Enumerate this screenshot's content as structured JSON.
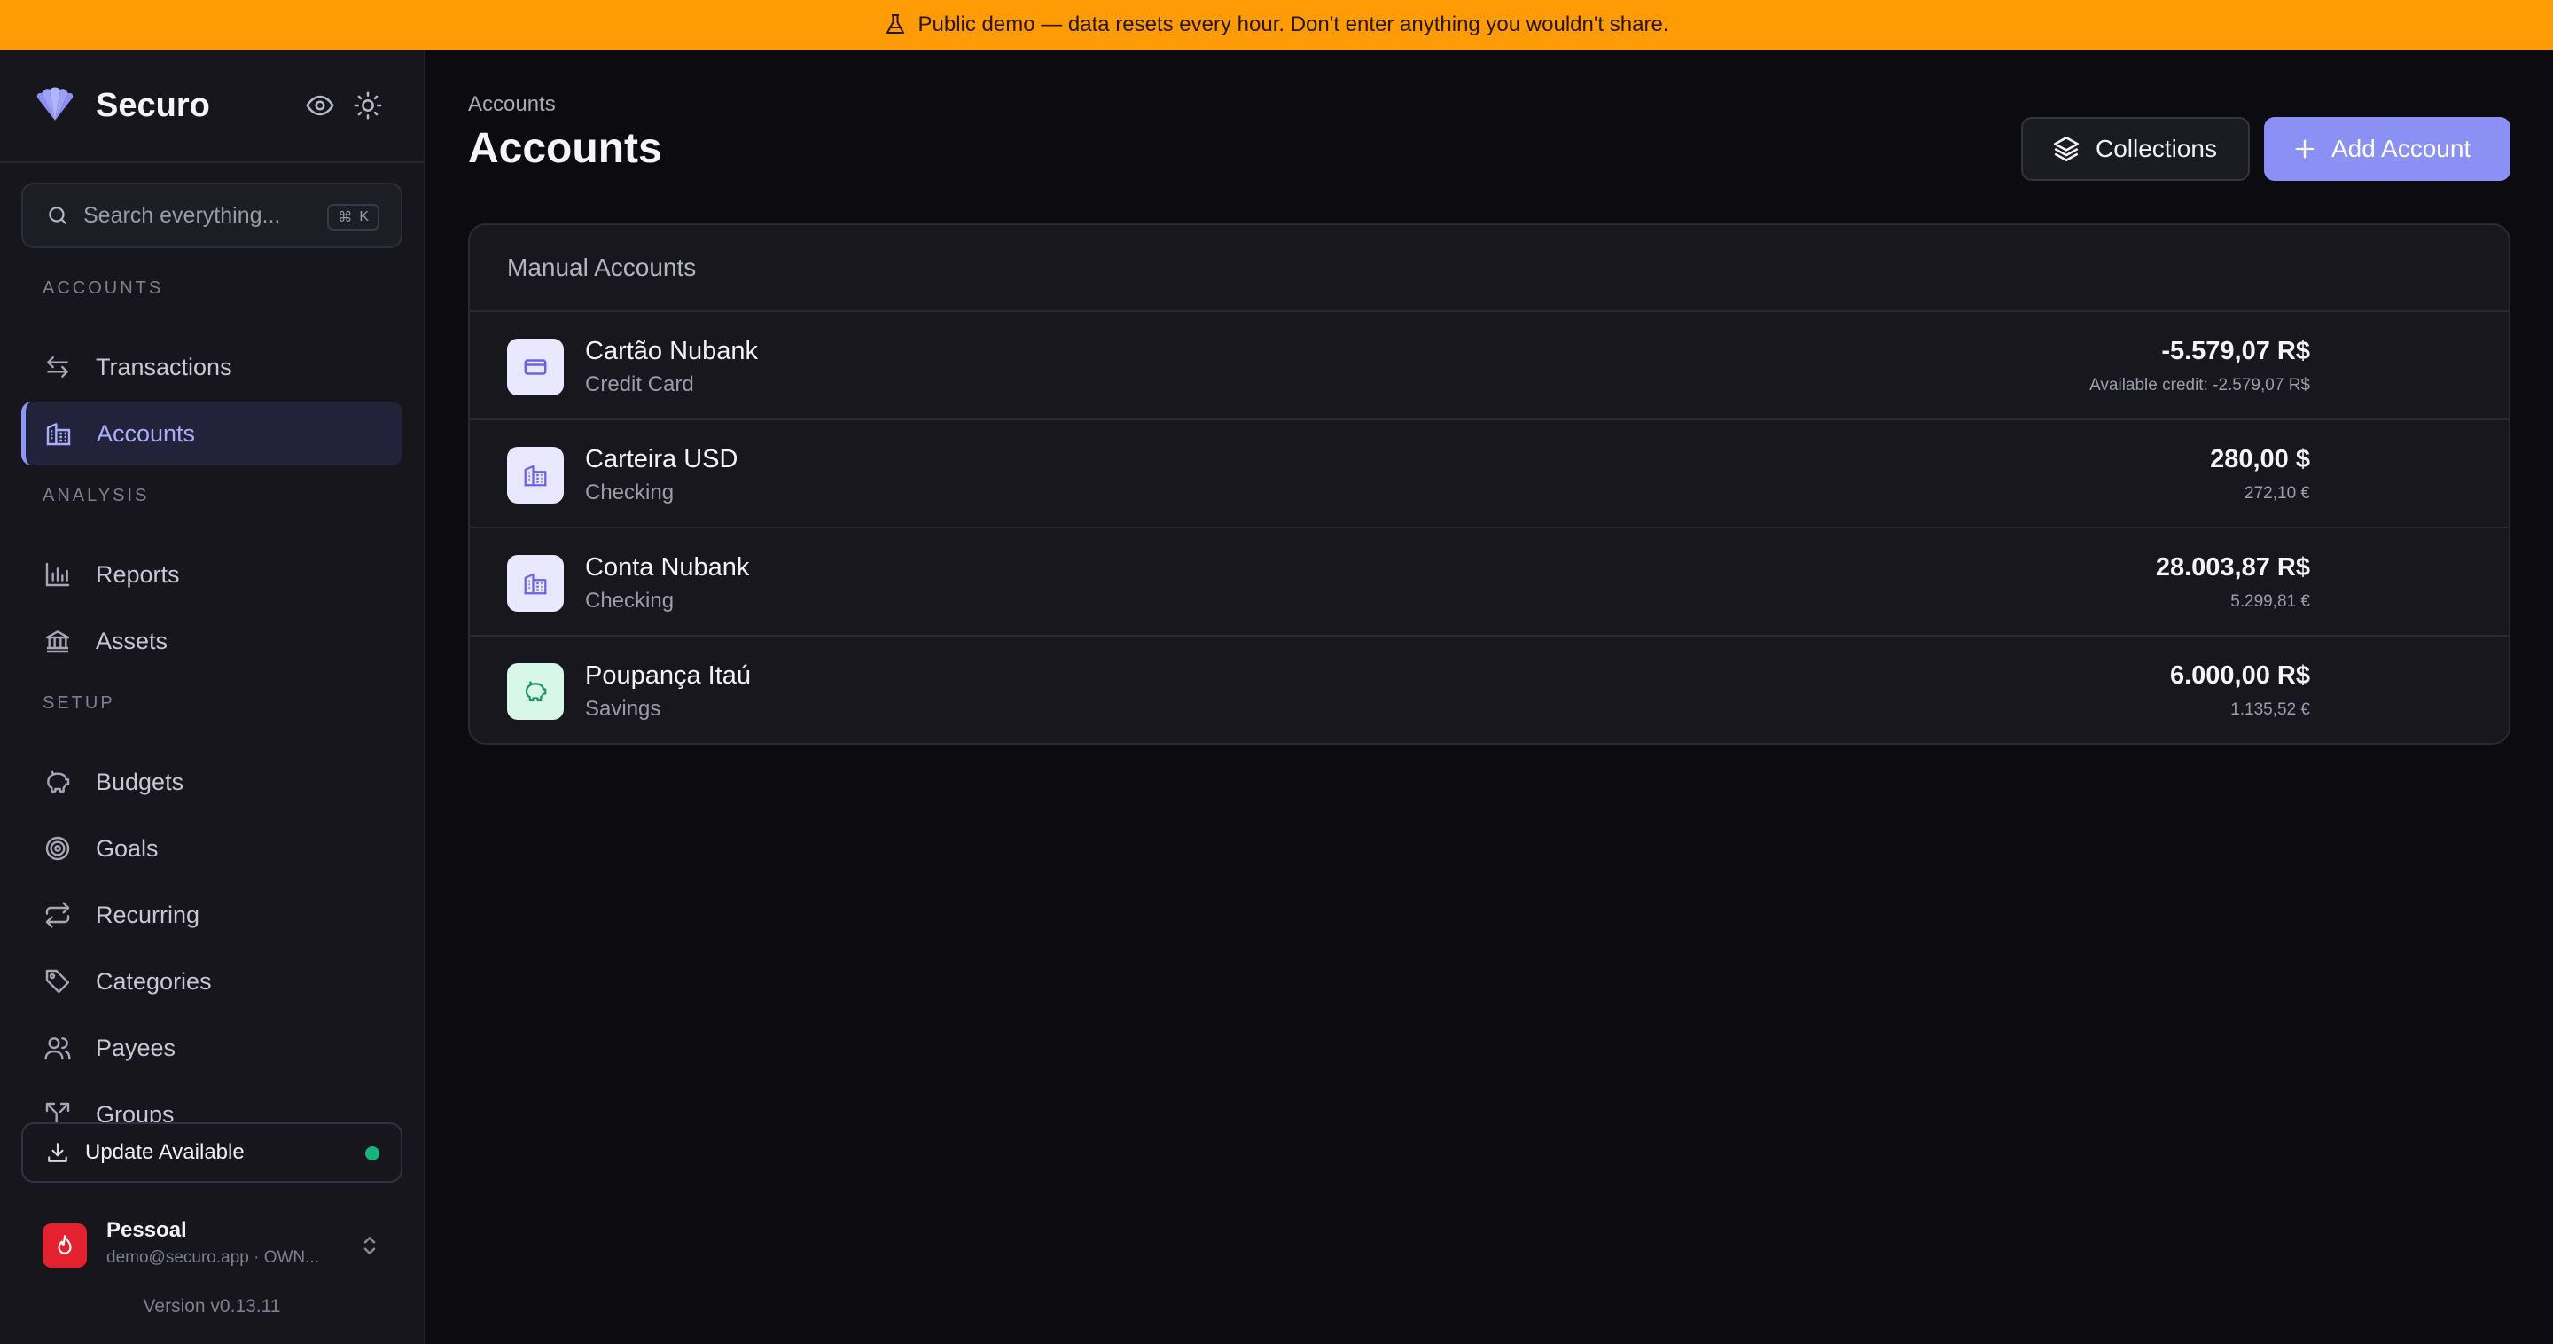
{
  "banner": {
    "text": "Public demo — data resets every hour. Don't enter anything you wouldn't share.",
    "icon": "flask-icon",
    "color": "#ff9b05"
  },
  "app": {
    "name": "Securo",
    "accent": "#8a90f4"
  },
  "search": {
    "placeholder": "Search everything...",
    "shortcut_mod": "⌘",
    "shortcut_key": "K"
  },
  "sidebar": {
    "sections": [
      {
        "title": "ACCOUNTS",
        "items": [
          {
            "label": "Transactions",
            "icon": "arrows-exchange-icon"
          },
          {
            "label": "Accounts",
            "icon": "building-icon",
            "active": true
          }
        ]
      },
      {
        "title": "ANALYSIS",
        "items": [
          {
            "label": "Reports",
            "icon": "bar-chart-icon"
          },
          {
            "label": "Assets",
            "icon": "bank-icon"
          }
        ]
      },
      {
        "title": "SETUP",
        "items": [
          {
            "label": "Budgets",
            "icon": "piggy-bank-icon"
          },
          {
            "label": "Goals",
            "icon": "target-icon"
          },
          {
            "label": "Recurring",
            "icon": "repeat-icon"
          },
          {
            "label": "Categories",
            "icon": "tag-icon"
          },
          {
            "label": "Payees",
            "icon": "users-icon"
          },
          {
            "label": "Groups",
            "icon": "split-icon"
          }
        ]
      }
    ],
    "update_label": "Update Available",
    "profile": {
      "name": "Pessoal",
      "sub": "demo@securo.app · OWN..."
    },
    "version": "Version v0.13.11"
  },
  "main": {
    "breadcrumb": "Accounts",
    "title": "Accounts",
    "collections_label": "Collections",
    "add_account_label": "Add Account",
    "panel_title": "Manual Accounts",
    "accounts": [
      {
        "name": "Cartão Nubank",
        "type": "Credit Card",
        "amount": "-5.579,07 R$",
        "sub": "Available credit: -2.579,07 R$",
        "icon": "credit-card-icon",
        "icon_bg": "#e9e8ff",
        "icon_color": "#6b63e6"
      },
      {
        "name": "Carteira USD",
        "type": "Checking",
        "amount": "280,00 $",
        "sub": "272,10 €",
        "icon": "building-icon",
        "icon_bg": "#e9e8ff",
        "icon_color": "#6b63e6"
      },
      {
        "name": "Conta Nubank",
        "type": "Checking",
        "amount": "28.003,87 R$",
        "sub": "5.299,81 €",
        "icon": "building-icon",
        "icon_bg": "#e9e8ff",
        "icon_color": "#6b63e6"
      },
      {
        "name": "Poupança Itaú",
        "type": "Savings",
        "amount": "6.000,00 R$",
        "sub": "1.135,52 €",
        "icon": "piggy-bank-icon",
        "icon_bg": "#d9f7e8",
        "icon_color": "#1a9a62"
      }
    ]
  }
}
